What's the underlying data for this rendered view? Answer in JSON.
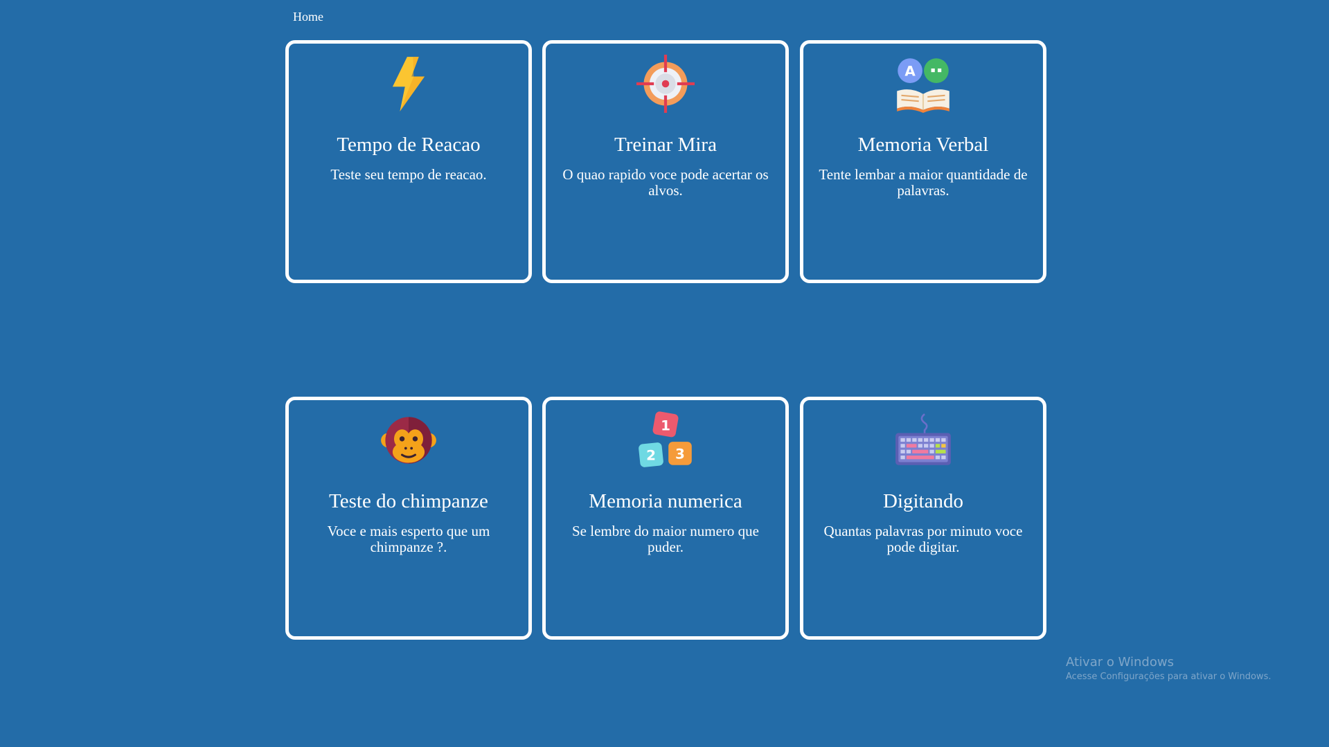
{
  "nav": {
    "home_label": "Home"
  },
  "cards": [
    {
      "title": "Tempo de Reacao",
      "description": "Teste seu tempo de reacao.",
      "icon": "lightning-bolt-icon"
    },
    {
      "title": "Treinar Mira",
      "description": "O quao rapido voce pode acertar os alvos.",
      "icon": "crosshair-target-icon"
    },
    {
      "title": "Memoria Verbal",
      "description": "Tente lembar a maior quantidade de palavras.",
      "icon": "open-book-chat-icon"
    },
    {
      "title": "Teste do chimpanze",
      "description": "Voce e mais esperto que um chimpanze ?.",
      "icon": "monkey-face-icon"
    },
    {
      "title": "Memoria numerica",
      "description": "Se lembre do maior numero que puder.",
      "icon": "number-blocks-icon"
    },
    {
      "title": "Digitando",
      "description": "Quantas palavras por minuto voce pode digitar.",
      "icon": "keyboard-icon"
    }
  ],
  "watermark": {
    "line1": "Ativar o Windows",
    "line2": "Acesse Configurações para ativar o Windows."
  },
  "colors": {
    "background": "#236ca8",
    "card_border": "#ffffff"
  }
}
